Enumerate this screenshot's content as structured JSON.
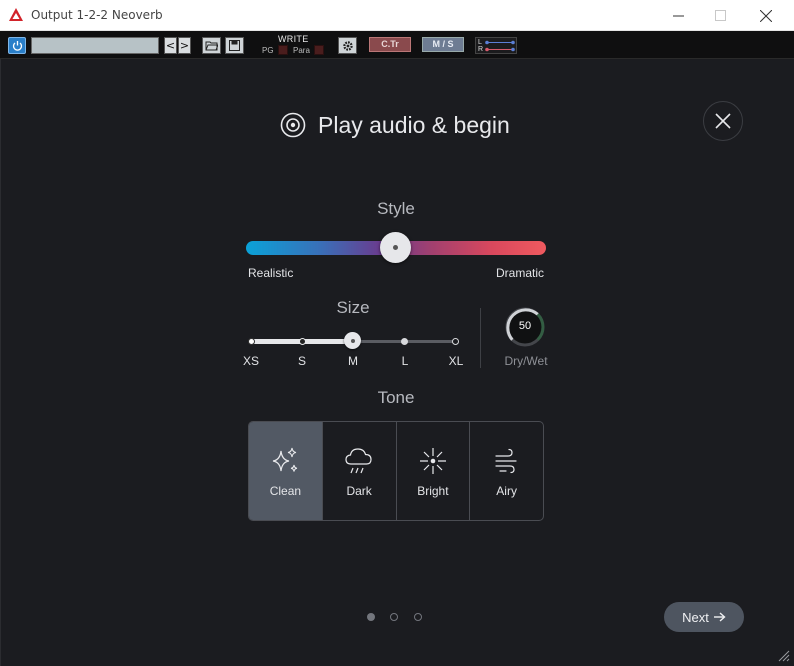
{
  "window": {
    "title": "Output 1-2-2 Neoverb"
  },
  "host_toolbar": {
    "preset_value": "",
    "write_label": "WRITE",
    "pg_label": "PG",
    "para_label": "Para",
    "ctr_label": "C.Tr",
    "ms_label": "M / S",
    "l_label": "L",
    "r_label": "R",
    "prev_arrow": "<",
    "next_arrow": ">"
  },
  "plugin": {
    "heading": "Play audio & begin",
    "style": {
      "label": "Style",
      "left_label": "Realistic",
      "right_label": "Dramatic",
      "value": 0.5
    },
    "size": {
      "label": "Size",
      "stops": [
        "XS",
        "S",
        "M",
        "L",
        "XL"
      ],
      "selected": "M"
    },
    "dry_wet": {
      "value": "50",
      "label": "Dry/Wet"
    },
    "tone": {
      "label": "Tone",
      "options": [
        {
          "label": "Clean",
          "icon": "sparkle-icon",
          "selected": true
        },
        {
          "label": "Dark",
          "icon": "rain-cloud-icon",
          "selected": false
        },
        {
          "label": "Bright",
          "icon": "sun-burst-icon",
          "selected": false
        },
        {
          "label": "Airy",
          "icon": "wind-icon",
          "selected": false
        }
      ]
    },
    "pagination": {
      "total": 3,
      "current": 1
    },
    "next_label": "Next"
  },
  "colors": {
    "background": "#1b1c20",
    "accent_selected": "#525964",
    "gradient_start": "#0aa2d8",
    "gradient_end": "#ef5a5f"
  }
}
